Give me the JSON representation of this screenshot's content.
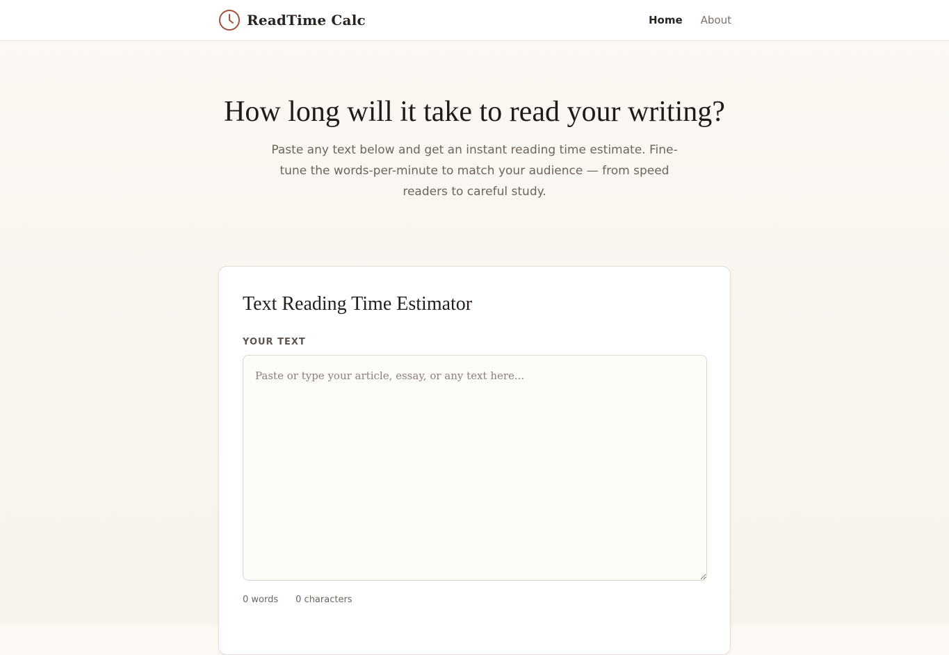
{
  "header": {
    "brand": "ReadTime Calc",
    "brand_icon": "clock-icon",
    "nav": [
      {
        "label": "Home",
        "active": true
      },
      {
        "label": "About",
        "active": false
      }
    ]
  },
  "hero": {
    "title": "How long will it take to read your writing?",
    "subtitle": "Paste any text below and get an instant reading time estimate. Fine-tune the words-per-minute to match your audience — from speed readers to careful study."
  },
  "estimator": {
    "title": "Text Reading Time Estimator",
    "field_label": "YOUR TEXT",
    "textarea_value": "",
    "textarea_placeholder": "Paste or type your article, essay, or any text here...",
    "word_count": "0 words",
    "char_count": "0 characters"
  },
  "colors": {
    "accent": "#a0523d",
    "background": "#faf6f0",
    "card": "#ffffff"
  }
}
